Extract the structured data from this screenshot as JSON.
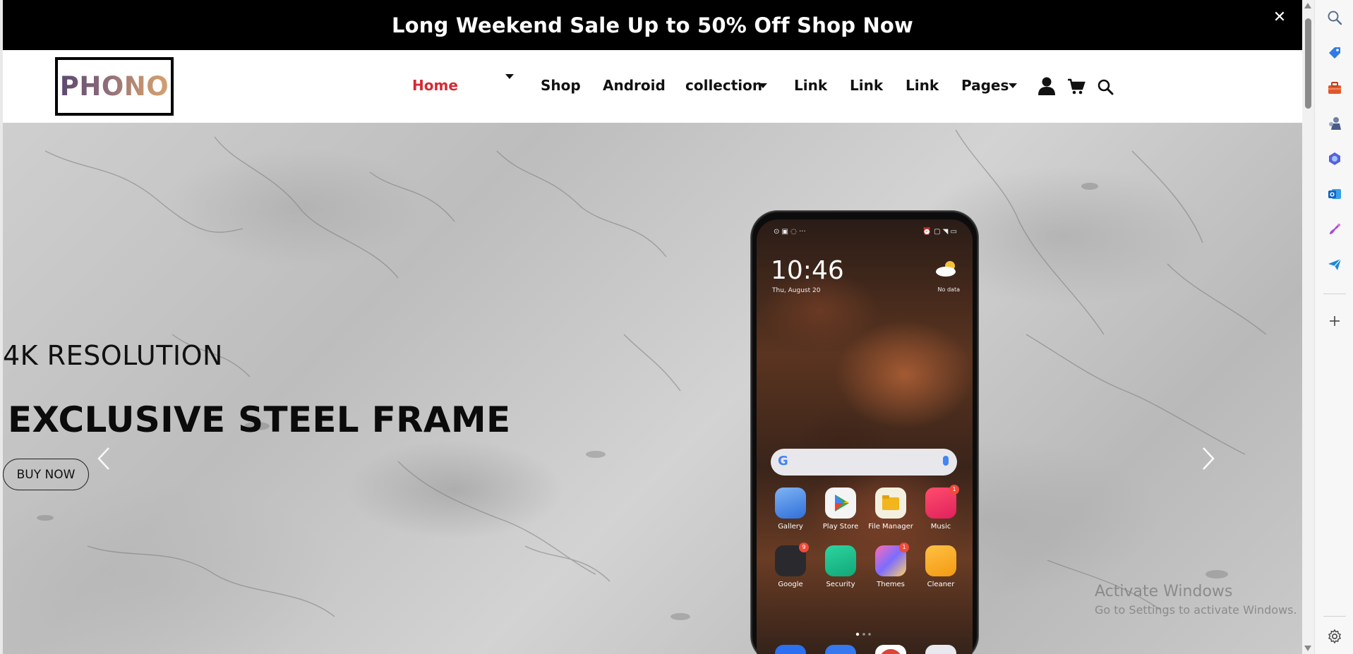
{
  "announcement": {
    "text": "Long Weekend Sale Up to 50% Off Shop Now",
    "close_symbol": "✕"
  },
  "header": {
    "logo_text": "PHONO",
    "nav": {
      "home": "Home",
      "shop": "Shop",
      "android": "Android",
      "collection": "collection",
      "link1": "Link",
      "link2": "Link",
      "link3": "Link",
      "pages": "Pages"
    },
    "icons": [
      "user-icon",
      "cart-icon",
      "search-icon"
    ],
    "active_color": "#d42a35"
  },
  "hero": {
    "subtitle": "4K RESOLUTION",
    "title": "EXCLUSIVE STEEL FRAME",
    "button_label": "BUY NOW",
    "phone": {
      "status_left": "⊙ ▣ ◌ ···",
      "status_right": "⏰ ▢ ◥ ▭",
      "time": "10:46",
      "date": "Thu, August 20",
      "weather": "No data",
      "apps": [
        {
          "label": "Gallery",
          "badge": ""
        },
        {
          "label": "Play Store",
          "badge": ""
        },
        {
          "label": "File Manager",
          "badge": ""
        },
        {
          "label": "Music",
          "badge": "1"
        },
        {
          "label": "Google",
          "badge": "9"
        },
        {
          "label": "Security",
          "badge": ""
        },
        {
          "label": "Themes",
          "badge": "1"
        },
        {
          "label": "Cleaner",
          "badge": ""
        }
      ]
    }
  },
  "watermark": {
    "title": "Activate Windows",
    "subtitle": "Go to Settings to activate Windows."
  },
  "edge_sidebar": {
    "icons": [
      "search-icon",
      "tag-icon",
      "toolbox-icon",
      "chess-icon",
      "copilot-icon",
      "outlook-icon",
      "designer-icon",
      "send-icon",
      "add-icon",
      "settings-icon"
    ]
  }
}
